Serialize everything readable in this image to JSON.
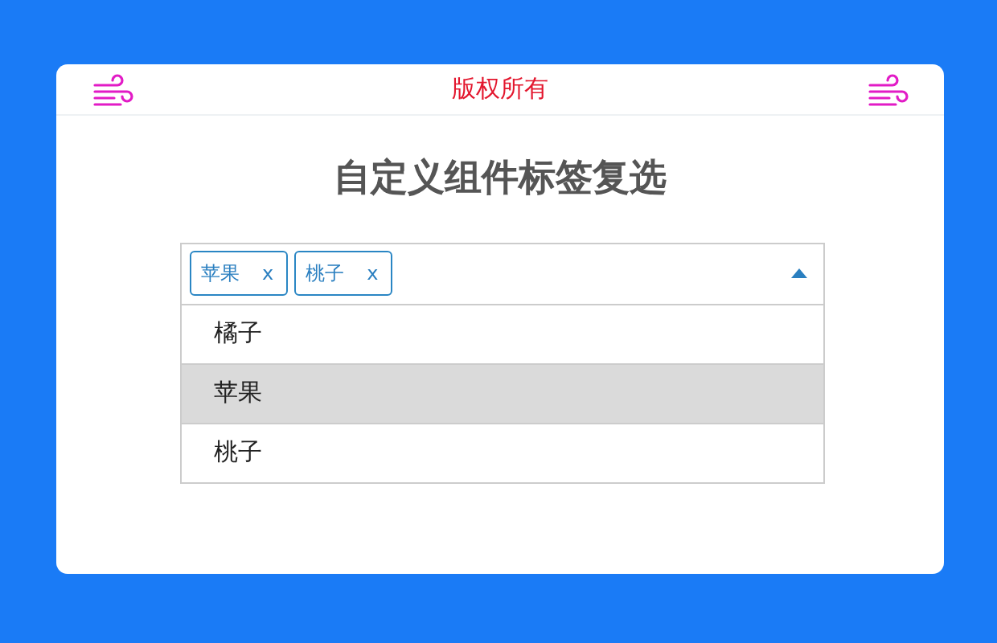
{
  "header": {
    "title": "版权所有"
  },
  "heading": "自定义组件标签复选",
  "select": {
    "expanded": true,
    "tags": [
      {
        "label": "苹果",
        "remove": "x"
      },
      {
        "label": "桃子",
        "remove": "x"
      }
    ],
    "options": [
      {
        "label": "橘子",
        "highlighted": false
      },
      {
        "label": "苹果",
        "highlighted": true
      },
      {
        "label": "桃子",
        "highlighted": false
      }
    ]
  }
}
